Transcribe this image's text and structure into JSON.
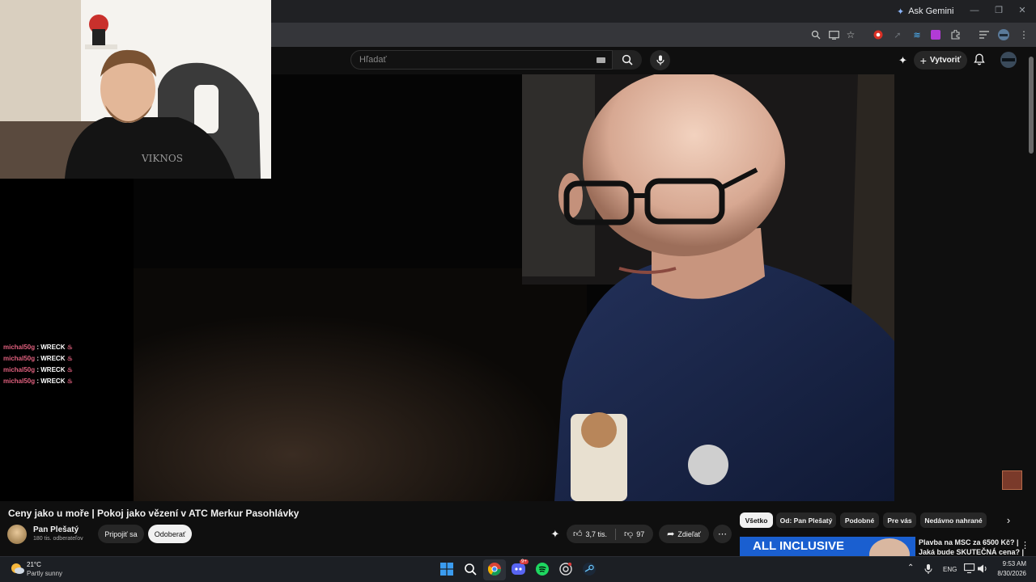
{
  "browser": {
    "ask_gemini": "Ask Gemini"
  },
  "header": {
    "search_placeholder": "Hľadať",
    "create_label": "Vytvoriť"
  },
  "chat": [
    {
      "user": "michal50g",
      "sep": " : ",
      "msg": "WRECK"
    },
    {
      "user": "michal50g",
      "sep": " : ",
      "msg": "WRECK"
    },
    {
      "user": "michal50g",
      "sep": " : ",
      "msg": "WRECK"
    },
    {
      "user": "michal50g",
      "sep": " : ",
      "msg": "WRECK"
    }
  ],
  "video": {
    "title": "Ceny jako u moře | Pokoj jako vězení v ATC Merkur Pasohlávky",
    "channel_name": "Pan Plešatý",
    "subscribers": "180 tis. odberateľov",
    "join_label": "Pripojiť sa",
    "unsubscribe_label": "Odoberať",
    "likes": "3,7 tis.",
    "dislikes": "97",
    "share_label": "Zdieľať"
  },
  "chips": [
    "Všetko",
    "Od: Pan Plešatý",
    "Podobné",
    "Pre vás",
    "Nedávno nahrané"
  ],
  "recommendation": {
    "thumb_text": "ALL INCLUSIVE",
    "title_line1": "Plavba na MSC za 6500 Kč? |",
    "title_line2": "Jaká bude SKUTEČNÁ cena? |"
  },
  "taskbar": {
    "temperature": "21°C",
    "weather": "Partly sunny",
    "language": "ENG",
    "time": "9:53 AM",
    "date": "8/30/2026",
    "discord_badge": "9+"
  },
  "colors": {
    "chat_user": "#e0607e",
    "youtube_bg": "#0f0f0f",
    "chip_active_bg": "#f1f1f1"
  }
}
